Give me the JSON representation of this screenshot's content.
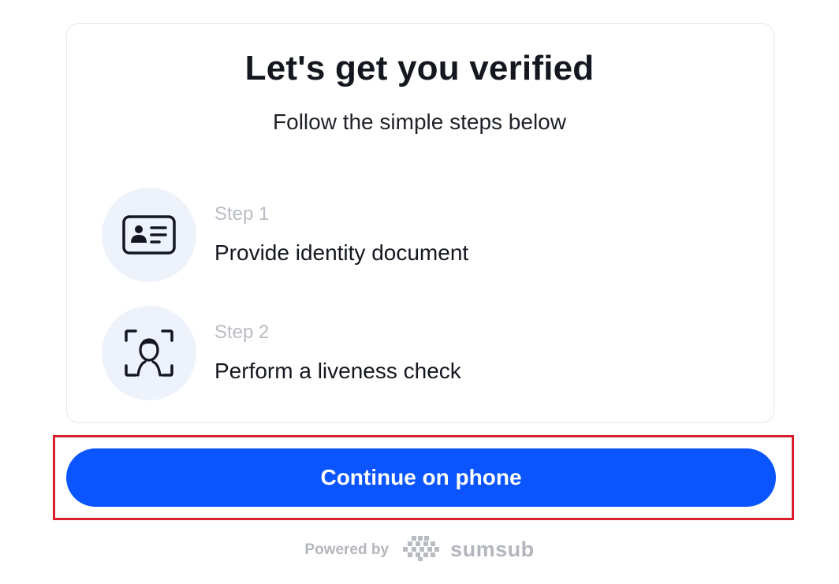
{
  "header": {
    "title": "Let's get you verified",
    "subtitle": "Follow the simple steps below"
  },
  "steps": [
    {
      "number": "Step 1",
      "description": "Provide identity document",
      "icon": "id-card-icon"
    },
    {
      "number": "Step 2",
      "description": "Perform a liveness check",
      "icon": "face-scan-icon"
    }
  ],
  "cta": {
    "label": "Continue on phone"
  },
  "footer": {
    "powered_by": "Powered by",
    "brand": "sumsub",
    "brand_icon": "sumsub-logo-icon"
  },
  "colors": {
    "primary": "#0a55ff",
    "highlight": "#d8202a",
    "icon_bg": "#eef2fb",
    "muted": "#b9bcc4"
  }
}
